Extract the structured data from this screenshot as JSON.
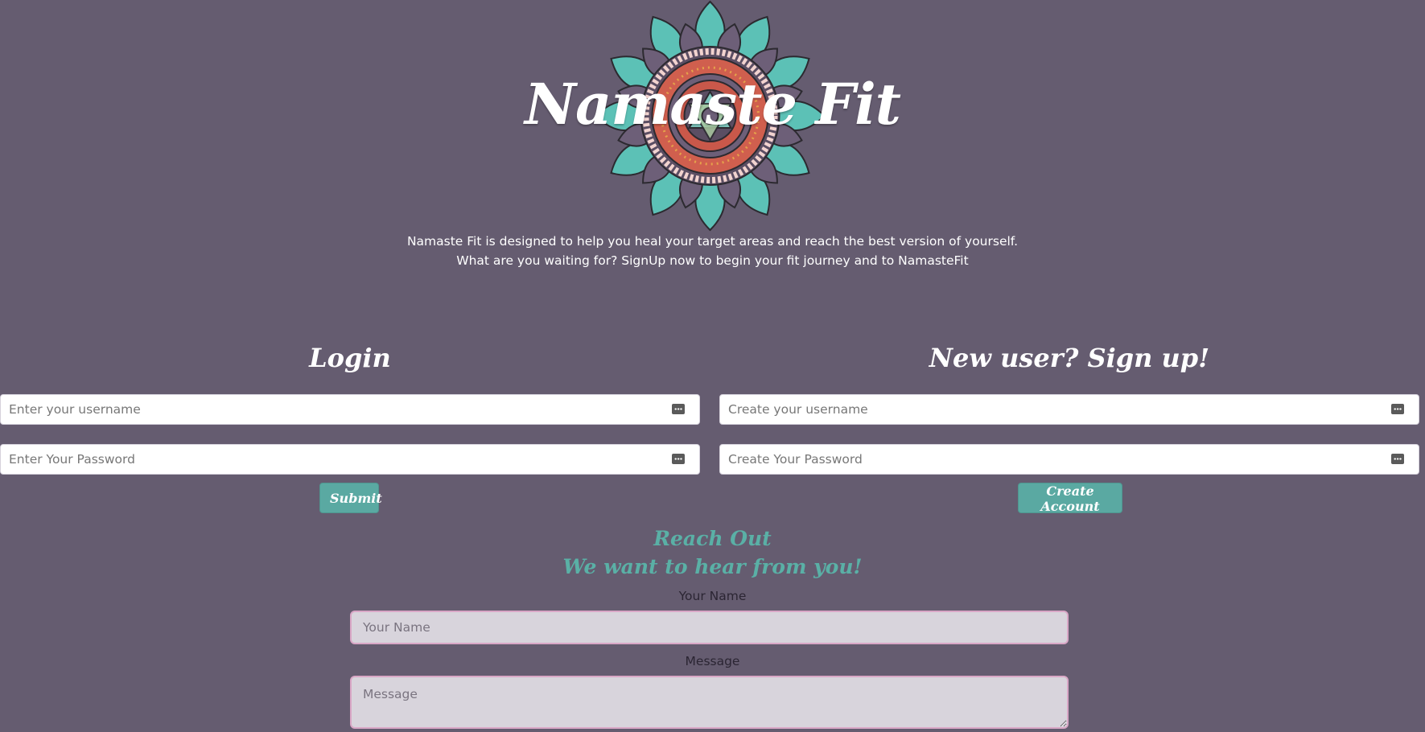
{
  "hero": {
    "brand": "Namaste Fit",
    "tagline_line1": "Namaste Fit is designed to help you heal your target areas and reach the best version of yourself.",
    "tagline_line2": "What are you waiting for? SignUp now to begin your fit journey and to NamasteFit"
  },
  "login": {
    "title": "Login",
    "username_placeholder": "Enter your username",
    "password_placeholder": "Enter Your Password",
    "submit_label": "Submit"
  },
  "signup": {
    "title": "New user? Sign up!",
    "username_placeholder": "Create your username",
    "password_placeholder": "Create Your Password",
    "submit_label": "Create Account"
  },
  "contact": {
    "heading1": "Reach Out",
    "heading2": "We want to hear from you!",
    "name_label": "Your Name",
    "name_placeholder": "Your Name",
    "message_label": "Message",
    "message_placeholder": "Message"
  },
  "icons": {
    "field_icon": "password-manager-key-icon",
    "logo": "mandala-logo"
  },
  "colors": {
    "background": "#655c70",
    "accent_teal": "#5aa9a2",
    "input_border_pink": "#d9a7c6"
  }
}
